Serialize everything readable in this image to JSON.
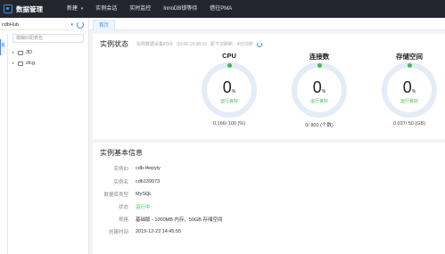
{
  "app": {
    "title": "数据管理"
  },
  "nav": [
    {
      "label": "新建",
      "caret": "▾"
    },
    {
      "label": "实例会话"
    },
    {
      "label": "实时监控"
    },
    {
      "label": "InnoDB锁等待"
    },
    {
      "label": "借往PMA"
    }
  ],
  "sidebar": {
    "instance": "cdbHub",
    "instance_caret": "▾",
    "side_tab": "集",
    "filter_placeholder": "模糊匹配表名",
    "tree": [
      {
        "arrow": "▸",
        "label": "3D"
      },
      {
        "arrow": "▸",
        "label": "zfcg"
      }
    ]
  },
  "tabs": [
    {
      "label": "首页"
    }
  ],
  "status": {
    "title": "实例状态",
    "collected_label": "实例数据采集时间:",
    "collected_time": "03-06 15:08:16",
    "countdown": "距下次刷新：4分20秒",
    "metrics": [
      {
        "title": "CPU",
        "value": "0",
        "unit": "%",
        "state": "运行良好",
        "usage": "0.166/ 100 (%)",
        "fill": 0
      },
      {
        "title": "连接数",
        "value": "0",
        "unit": "%",
        "state": "运行良好",
        "usage": "0/ 800 (个数)",
        "fill": 0
      },
      {
        "title": "存储空间",
        "value": "0",
        "unit": "%",
        "state": "运行良好",
        "usage": "0.037/ 50 (GB)",
        "fill": 0
      }
    ]
  },
  "info": {
    "title": "实例基本信息",
    "rows": [
      {
        "label": "实例ID",
        "value": "cdb-l4epyiy"
      },
      {
        "label": "实例名",
        "value": "cdb139073"
      },
      {
        "label": "数据库类型",
        "value": "MySQL"
      },
      {
        "label": "状态",
        "value": "运行中"
      },
      {
        "label": "规格",
        "value": "基础版 - 1000MB 内存，50GB 存储空间"
      },
      {
        "label": "创建时间",
        "value": "2019-12-23 14:45:55"
      }
    ]
  },
  "colors": {
    "accent": "#3d8fe6",
    "ok": "#49b855",
    "topbar": "#23262e"
  }
}
